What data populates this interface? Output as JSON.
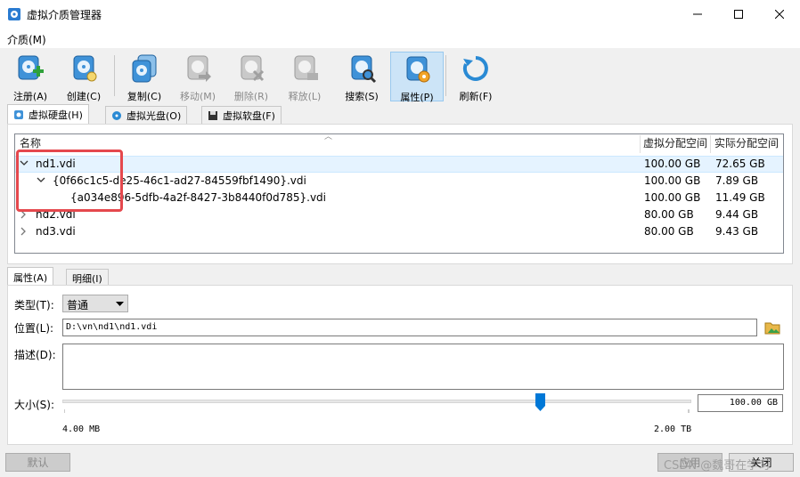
{
  "window": {
    "title": "虚拟介质管理器"
  },
  "menu": {
    "items": [
      {
        "label": "介质(M)"
      }
    ]
  },
  "toolbar": {
    "buttons": [
      {
        "label": "注册(A)",
        "icon": "add-disk-icon",
        "enabled": true
      },
      {
        "label": "创建(C)",
        "icon": "create-disk-icon",
        "enabled": true
      },
      {
        "label": "复制(C)",
        "icon": "copy-disk-icon",
        "enabled": true
      },
      {
        "label": "移动(M)",
        "icon": "move-disk-icon",
        "enabled": false
      },
      {
        "label": "删除(R)",
        "icon": "remove-disk-icon",
        "enabled": false
      },
      {
        "label": "释放(L)",
        "icon": "release-disk-icon",
        "enabled": false
      },
      {
        "label": "搜索(S)",
        "icon": "search-disk-icon",
        "enabled": true
      },
      {
        "label": "属性(P)",
        "icon": "properties-disk-icon",
        "enabled": true,
        "active": true
      },
      {
        "label": "刷新(F)",
        "icon": "refresh-icon",
        "enabled": true
      }
    ]
  },
  "tabs": [
    {
      "label": "虚拟硬盘(H)",
      "selected": true
    },
    {
      "label": "虚拟光盘(O)",
      "selected": false
    },
    {
      "label": "虚拟软盘(F)",
      "selected": false
    }
  ],
  "table": {
    "columns": [
      "名称",
      "虚拟分配空间",
      "实际分配空间"
    ],
    "rows": [
      {
        "name": "nd1.vdi",
        "virtual": "100.00 GB",
        "actual": "72.65 GB",
        "level": 0,
        "expanded": true,
        "selected": true
      },
      {
        "name": "{0f66c1c5-de25-46c1-ad27-84559fbf1490}.vdi",
        "virtual": "100.00 GB",
        "actual": "7.89 GB",
        "level": 1,
        "expanded": true
      },
      {
        "name": "{a034e896-5dfb-4a2f-8427-3b8440f0d785}.vdi",
        "virtual": "100.00 GB",
        "actual": "11.49 GB",
        "level": 2
      },
      {
        "name": "nd2.vdi",
        "virtual": "80.00 GB",
        "actual": "9.44 GB",
        "level": 0,
        "expanded": false
      },
      {
        "name": "nd3.vdi",
        "virtual": "80.00 GB",
        "actual": "9.43 GB",
        "level": 0,
        "expanded": false
      }
    ]
  },
  "detail_tabs": [
    {
      "label": "属性(A)",
      "selected": true
    },
    {
      "label": "明细(I)",
      "selected": false
    }
  ],
  "properties": {
    "type_label": "类型(T):",
    "type_value": "普通",
    "location_label": "位置(L):",
    "location_value": "D:\\vn\\nd1\\nd1.vdi",
    "description_label": "描述(D):",
    "description_value": "",
    "size_label": "大小(S):",
    "size_value": "100.00 GB",
    "size_fraction": 0.76,
    "slider_min": "4.00 MB",
    "slider_max": "2.00 TB"
  },
  "footer": {
    "reset_label": "默认",
    "apply_label": "应用",
    "close_label": "关闭",
    "watermark": "CSDN @魏哥在学习"
  },
  "colors": {
    "accent": "#0078d7",
    "selection": "#e5f3ff",
    "highlight": "#e5484d"
  }
}
